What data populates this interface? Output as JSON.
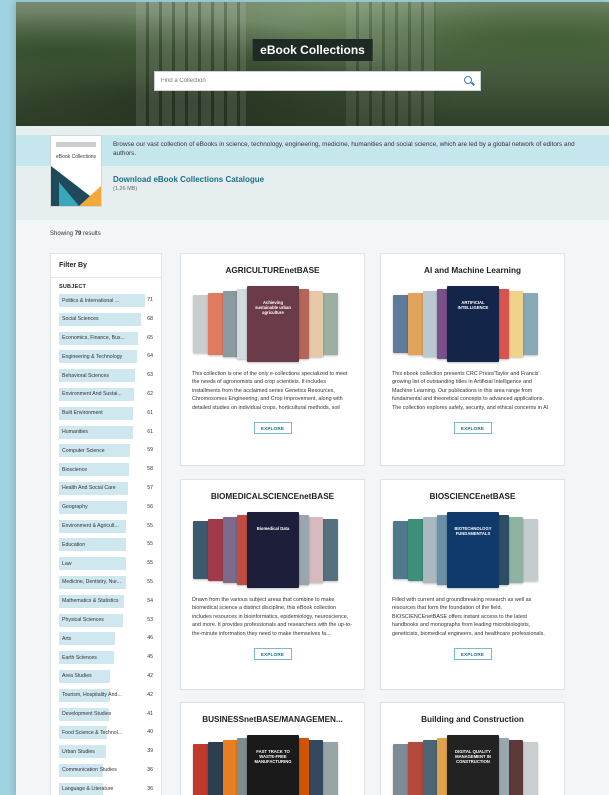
{
  "hero": {
    "title": "eBook Collections",
    "search_placeholder": "Find a Collection"
  },
  "intro": {
    "description": "Browse our vast collection of eBooks in science, technology, engineering, medicine, humanities and social science, which are led by a global network of editors and authors.",
    "download_label": "Download eBook Collections Catalogue",
    "download_size": "(1.26 MB)",
    "cover_title": "eBook Collections"
  },
  "results": {
    "prefix": "Showing",
    "count": "79",
    "suffix": "results"
  },
  "filter": {
    "heading": "Filter By",
    "subject_heading": "SUBJECT",
    "items": [
      {
        "label": "Politics & International ...",
        "count": 71
      },
      {
        "label": "Social Sciences",
        "count": 68
      },
      {
        "label": "Economics, Finance, Bus...",
        "count": 65
      },
      {
        "label": "Engineering & Technology",
        "count": 64
      },
      {
        "label": "Behavioral Sciences",
        "count": 63
      },
      {
        "label": "Environment And Sustai...",
        "count": 62
      },
      {
        "label": "Built Environment",
        "count": 61
      },
      {
        "label": "Humanities",
        "count": 61
      },
      {
        "label": "Computer Science",
        "count": 59
      },
      {
        "label": "Bioscience",
        "count": 58
      },
      {
        "label": "Health And Social Care",
        "count": 57
      },
      {
        "label": "Geography",
        "count": 56
      },
      {
        "label": "Environment & Agricult...",
        "count": 55
      },
      {
        "label": "Education",
        "count": 55
      },
      {
        "label": "Law",
        "count": 55
      },
      {
        "label": "Medicine, Dentistry, Nur...",
        "count": 55
      },
      {
        "label": "Mathematics & Statistics",
        "count": 54
      },
      {
        "label": "Physical Sciences",
        "count": 53
      },
      {
        "label": "Arts",
        "count": 46
      },
      {
        "label": "Earth Sciences",
        "count": 45
      },
      {
        "label": "Area Studies",
        "count": 42
      },
      {
        "label": "Tourism, Hospitality And...",
        "count": 42
      },
      {
        "label": "Development Studies",
        "count": 41
      },
      {
        "label": "Food Science & Technol...",
        "count": 40
      },
      {
        "label": "Urban Studies",
        "count": 39
      },
      {
        "label": "Communication Studies",
        "count": 36
      },
      {
        "label": "Language & Literature",
        "count": 36
      }
    ]
  },
  "explore_label": "EXPLORE",
  "cards": [
    {
      "title": "AGRICULTUREnetBASE",
      "description": "This collection is one of the only e-collections specialized to meet the needs of agronomists and crop scientists. It includes installments from the acclaimed series Genetics Resources, Chromosomes Engineering, and Crop Improvement, along with detailed studies on individual crops, horticultural methods, soil fertility, c...",
      "front_cover_text": "Achieving sustainable urban agriculture",
      "front_color": "#6b3b4a",
      "colors": [
        "#c9cdd0",
        "#e07b62",
        "#8a9aa0",
        "#d2dbe0",
        "#b5655a",
        "#e6c9a8",
        "#9bb0a3"
      ]
    },
    {
      "title": "AI and Machine Learning",
      "description": "This ebook collection presents CRC Press/Taylor and Francis' growing list of outstanding titles in Artificial Intelligence and Machine Learning. Our publications in this area range from fundamental and theoretical concepts to advanced applications. The collection explores safety, security, and ethical concerns in AI a...",
      "front_cover_text": "ARTIFICIAL INTELLIGENCE",
      "front_color": "#13264a",
      "colors": [
        "#5f7b9c",
        "#e2a35a",
        "#b9c8d2",
        "#7a4f8a",
        "#d9534f",
        "#f0d38a",
        "#88a8b8"
      ]
    },
    {
      "title": "BIOMEDICALSCIENCEnetBASE",
      "description": "Drawn from the various subject areas that combine to make biomedical science a distinct discipline, this eBook collection includes resources in bioinformatics, epidemiology, neuroscience, and more. It provides professionals and researchers with the up-to-the-minute information they need to make themselves fa...",
      "front_cover_text": "Biomedical Data",
      "front_color": "#1d1f3a",
      "colors": [
        "#3c5a6e",
        "#a03a4a",
        "#7d6a8a",
        "#c14d3f",
        "#9aa6ad",
        "#d7b9c0",
        "#55707e"
      ]
    },
    {
      "title": "BIOSCIENCEnetBASE",
      "description": "Filled with current and groundbreaking research as well as resources that form the foundation of the field, BIOSCIENCEnetBASE offers instant access to the latest handbooks and monographs from leading microbiologists, geneticists, biomedical engineers, and healthcare professionals.",
      "front_cover_text": "BIOTECHNOLOGY FUNDAMENTALS",
      "front_color": "#0f3a6b",
      "colors": [
        "#4f7a8c",
        "#3d8f7a",
        "#aab9c0",
        "#6a8fa8",
        "#2d4f63",
        "#8fb3a0",
        "#c4ccd0"
      ]
    },
    {
      "title": "BUSINESSnetBASE/MANAGEMEN...",
      "description": "",
      "front_cover_text": "FAST TRACK TO WASTE-FREE MANUFACTURING",
      "front_color": "#1a1a1a",
      "colors": [
        "#c0392b",
        "#2c3e50",
        "#e67e22",
        "#7f8c8d",
        "#d35400",
        "#34495e",
        "#95a5a6"
      ]
    },
    {
      "title": "Building and Construction",
      "description": "",
      "front_cover_text": "DIGITAL QUALITY MANAGEMENT IN CONSTRUCTION",
      "front_color": "#222222",
      "colors": [
        "#7b8c96",
        "#b34a3c",
        "#4d6472",
        "#e0a24a",
        "#99a7ae",
        "#5d3a3a",
        "#c9ced1"
      ]
    }
  ]
}
